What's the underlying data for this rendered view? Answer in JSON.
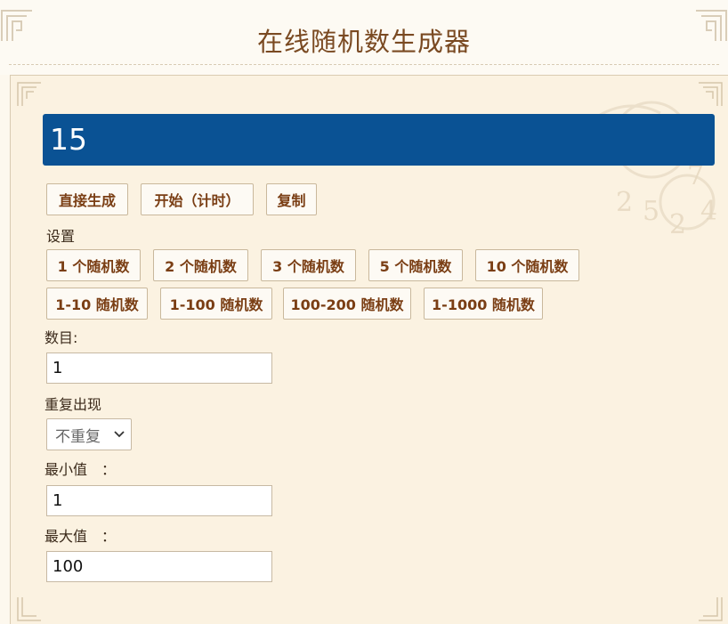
{
  "header": {
    "title": "在线随机数生成器"
  },
  "result": {
    "value": "15"
  },
  "actions": {
    "generate_label": "直接生成",
    "start_timed_label": "开始（计时）",
    "copy_label": "复制"
  },
  "settings": {
    "heading": "设置",
    "count_presets": [
      "1 个随机数",
      "2 个随机数",
      "3 个随机数",
      "5 个随机数",
      "10 个随机数"
    ],
    "range_presets": [
      "1-10 随机数",
      "1-100 随机数",
      "100-200 随机数",
      "1-1000 随机数"
    ]
  },
  "form": {
    "count_label": "数目:",
    "count_value": "1",
    "repeat_label": "重复出现",
    "repeat_selected": "不重复",
    "min_label": "最小值　：",
    "min_value": "1",
    "max_label": "最大值　：",
    "max_value": "100"
  }
}
